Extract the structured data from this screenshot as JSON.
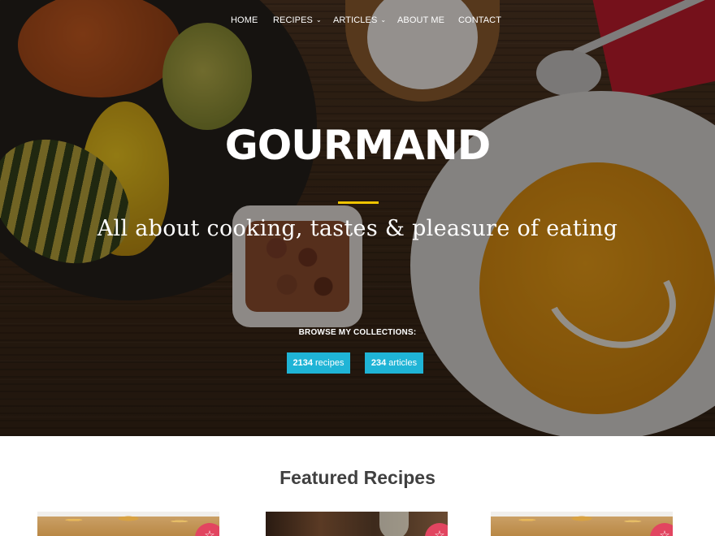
{
  "nav": {
    "items": [
      {
        "label": "HOME",
        "dropdown": false
      },
      {
        "label": "RECIPES",
        "dropdown": true
      },
      {
        "label": "ARTICLES",
        "dropdown": true
      },
      {
        "label": "ABOUT ME",
        "dropdown": false
      },
      {
        "label": "CONTACT",
        "dropdown": false
      }
    ]
  },
  "hero": {
    "title": "GOURMAND",
    "subtitle": "All about cooking, tastes & pleasure of eating",
    "browse_label": "BROWSE MY COLLECTIONS:",
    "recipes_count": "2134",
    "recipes_label": "recipes",
    "articles_count": "234",
    "articles_label": "articles",
    "accent_color": "#f0c400",
    "button_color": "#1fb4d6"
  },
  "featured": {
    "title": "Featured Recipes",
    "favorite_icon": "star-icon",
    "favorite_color": "#e24560"
  }
}
